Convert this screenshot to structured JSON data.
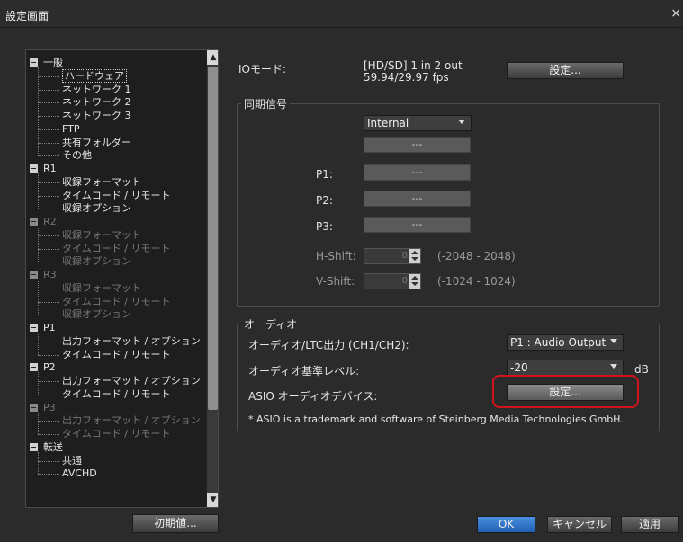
{
  "window": {
    "title": "設定画面",
    "close_glyph": "×"
  },
  "tree": {
    "items": [
      {
        "label": "一般",
        "level": 0,
        "disabled": false,
        "expander": true
      },
      {
        "label": "ハードウェア",
        "level": 1,
        "disabled": false,
        "selected": true
      },
      {
        "label": "ネットワーク 1",
        "level": 1,
        "disabled": false
      },
      {
        "label": "ネットワーク 2",
        "level": 1,
        "disabled": false
      },
      {
        "label": "ネットワーク 3",
        "level": 1,
        "disabled": false
      },
      {
        "label": "FTP",
        "level": 1,
        "disabled": false
      },
      {
        "label": "共有フォルダー",
        "level": 1,
        "disabled": false
      },
      {
        "label": "その他",
        "level": 1,
        "disabled": false
      },
      {
        "label": "R1",
        "level": 0,
        "disabled": false,
        "expander": true
      },
      {
        "label": "収録フォーマット",
        "level": 1,
        "disabled": false
      },
      {
        "label": "タイムコード / リモート",
        "level": 1,
        "disabled": false
      },
      {
        "label": "収録オプション",
        "level": 1,
        "disabled": false
      },
      {
        "label": "R2",
        "level": 0,
        "disabled": true,
        "expander": true
      },
      {
        "label": "収録フォーマット",
        "level": 1,
        "disabled": true
      },
      {
        "label": "タイムコード / リモート",
        "level": 1,
        "disabled": true
      },
      {
        "label": "収録オプション",
        "level": 1,
        "disabled": true
      },
      {
        "label": "R3",
        "level": 0,
        "disabled": true,
        "expander": true
      },
      {
        "label": "収録フォーマット",
        "level": 1,
        "disabled": true
      },
      {
        "label": "タイムコード / リモート",
        "level": 1,
        "disabled": true
      },
      {
        "label": "収録オプション",
        "level": 1,
        "disabled": true
      },
      {
        "label": "P1",
        "level": 0,
        "disabled": false,
        "expander": true
      },
      {
        "label": "出力フォーマット / オプション",
        "level": 1,
        "disabled": false
      },
      {
        "label": "タイムコード / リモート",
        "level": 1,
        "disabled": false
      },
      {
        "label": "P2",
        "level": 0,
        "disabled": false,
        "expander": true
      },
      {
        "label": "出力フォーマット / オプション",
        "level": 1,
        "disabled": false
      },
      {
        "label": "タイムコード / リモート",
        "level": 1,
        "disabled": false
      },
      {
        "label": "P3",
        "level": 0,
        "disabled": true,
        "expander": true
      },
      {
        "label": "出力フォーマット / オプション",
        "level": 1,
        "disabled": true
      },
      {
        "label": "タイムコード / リモート",
        "level": 1,
        "disabled": true
      },
      {
        "label": "転送",
        "level": 0,
        "disabled": false,
        "expander": true
      },
      {
        "label": "共通",
        "level": 1,
        "disabled": false
      },
      {
        "label": "AVCHD",
        "level": 1,
        "disabled": false
      }
    ]
  },
  "defaults_button": "初期値...",
  "io": {
    "label": "IOモード:",
    "value_line1": "[HD/SD] 1 in 2 out",
    "value_line2": "59.94/29.97 fps",
    "settings_button": "設定..."
  },
  "sync": {
    "group_title": "同期信号",
    "source_select": "Internal",
    "field_blank": "---",
    "p1_label": "P1:",
    "p1_value": "---",
    "p2_label": "P2:",
    "p2_value": "---",
    "p3_label": "P3:",
    "p3_value": "---",
    "hshift_label": "H-Shift:",
    "hshift_value": "0",
    "hshift_range": "(-2048 - 2048)",
    "vshift_label": "V-Shift:",
    "vshift_value": "0",
    "vshift_range": "(-1024 - 1024)"
  },
  "audio": {
    "group_title": "オーディオ",
    "ltc_label": "オーディオ/LTC出力 (CH1/CH2):",
    "ltc_select": "P1 : Audio Output",
    "level_label": "オーディオ基準レベル:",
    "level_select": "-20",
    "level_unit": "dB",
    "asio_label": "ASIO オーディオデバイス:",
    "asio_button": "設定...",
    "note": "* ASIO is a trademark and software of Steinberg Media Technologies GmbH."
  },
  "footer": {
    "ok": "OK",
    "cancel": "キャンセル",
    "apply": "適用"
  },
  "colors": {
    "highlight": "#d0141c",
    "primary": "#2f74c9"
  }
}
